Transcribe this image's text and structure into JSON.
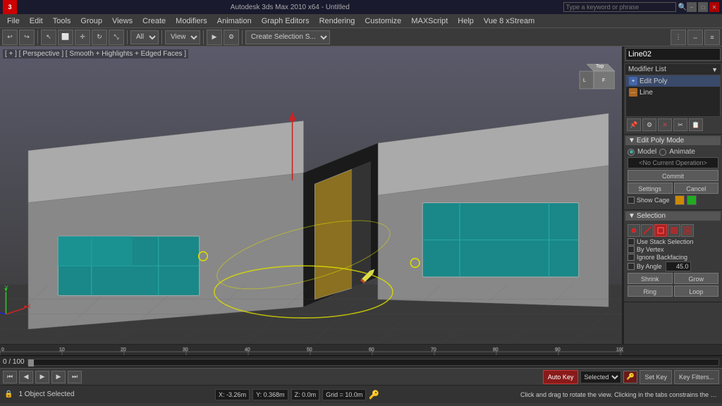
{
  "titlebar": {
    "title": "Autodesk 3ds Max 2010 x64 - Untitled",
    "search_placeholder": "Type a keyword or phrase"
  },
  "menubar": {
    "items": [
      "File",
      "Edit",
      "Tools",
      "Group",
      "Views",
      "Create",
      "Modifiers",
      "Animation",
      "Graph Editors",
      "Rendering",
      "Customize",
      "MAXScript",
      "Help",
      "Vue 8 xStream"
    ]
  },
  "viewport": {
    "label": "[ + ] [ Perspective ] [ Smooth + Highlights + Edged Faces ]",
    "object_selected": "1 Object Selected",
    "drag_hint": "Click and drag to rotate the view.  Clicking in the tabs constrains the rotation"
  },
  "right_panel": {
    "object_name": "Line02",
    "modifier_list_label": "Modifier List",
    "modifiers": [
      {
        "name": "Edit Poly",
        "type": "blue"
      },
      {
        "name": "Line",
        "type": "orange"
      }
    ],
    "edit_poly_mode": {
      "title": "Edit Poly Mode",
      "model_label": "Model",
      "animate_label": "Animate",
      "current_op_label": "<No Current Operation>",
      "commit_label": "Commit",
      "settings_label": "Settings",
      "cancel_label": "Cancel",
      "show_cage_label": "Show Cage"
    },
    "selection": {
      "title": "Selection",
      "use_stack_label": "Use Stack Selection",
      "by_vertex_label": "By Vertex",
      "ignore_backfacing_label": "Ignore Backfacing",
      "by_angle_label": "By Angle",
      "angle_value": "45.0",
      "shrink_label": "Shrink",
      "grow_label": "Grow",
      "ring_label": "Ring",
      "loop_label": "Loop"
    }
  },
  "timeline": {
    "range": "0 / 100"
  },
  "statusbar": {
    "selected_label": "1 Object Selected",
    "hint": "Click and drag to rotate the view.  Clicking in the tabs constrains the rotation",
    "x_coord": "X: -3.26m",
    "y_coord": "Y: 0.368m",
    "z_coord": "Z: 0.0m",
    "grid_label": "Grid = 10.0m",
    "auto_key_label": "Auto Key",
    "selected_option": "Selected",
    "set_key_label": "Set Key",
    "key_filters_label": "Key Filters..."
  },
  "toolbar": {
    "view_label": "View",
    "all_label": "All",
    "create_selection_label": "Create Selection S..."
  }
}
